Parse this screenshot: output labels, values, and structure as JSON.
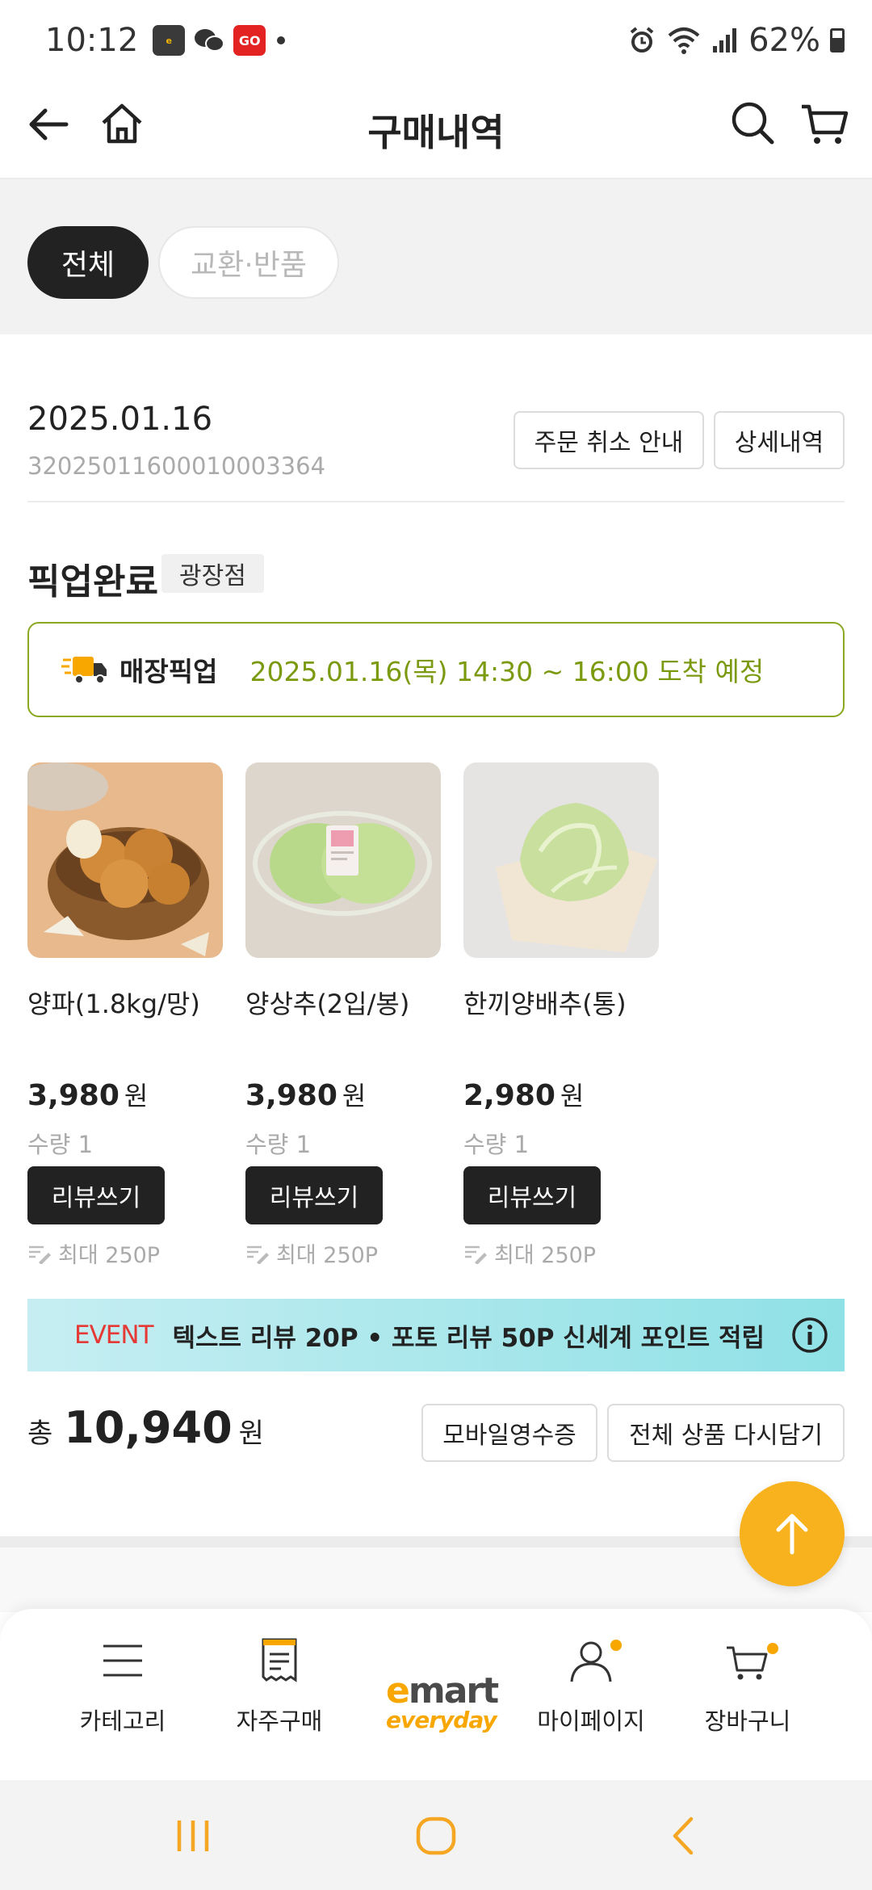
{
  "status_bar": {
    "time": "10:12",
    "battery": "62%",
    "app_icons": [
      "emart-emile-icon",
      "wechat-icon",
      "go-app-icon"
    ],
    "go_label": "GO"
  },
  "header": {
    "title": "구매내역"
  },
  "tabs": {
    "all": "전체",
    "exchange_return": "교환·반품"
  },
  "order": {
    "date": "2025.01.16",
    "number": "32025011600010003364",
    "cancel_guide_label": "주문 취소 안내",
    "detail_label": "상세내역",
    "status": "픽업완료",
    "store": "광장점",
    "pickup_type": "매장픽업",
    "pickup_time": "2025.01.16(목) 14:30 ~ 16:00 도착 예정"
  },
  "products": [
    {
      "name": "양파(1.8kg/망)",
      "price": "3,980",
      "currency": "원",
      "quantity": "수량 1",
      "review_label": "리뷰쓰기",
      "points": "최대 250P"
    },
    {
      "name": "양상추(2입/봉)",
      "price": "3,980",
      "currency": "원",
      "quantity": "수량 1",
      "review_label": "리뷰쓰기",
      "points": "최대 250P"
    },
    {
      "name": "한끼양배추(통)",
      "price": "2,980",
      "currency": "원",
      "quantity": "수량 1",
      "review_label": "리뷰쓰기",
      "points": "최대 250P"
    }
  ],
  "event": {
    "label": "EVENT",
    "text": "텍스트 리뷰 20P • 포토 리뷰 50P 신세계 포인트 적립"
  },
  "total": {
    "prefix": "총",
    "amount": "10,940",
    "unit": "원",
    "receipt_label": "모바일영수증",
    "reorder_label": "전체 상품 다시담기"
  },
  "bottom_nav": {
    "category": "카테고리",
    "frequent": "자주구매",
    "logo_line1": "emart",
    "logo_line2": "everyday",
    "mypage": "마이페이지",
    "cart": "장바구니"
  },
  "colors": {
    "accent": "#f8b21d",
    "pickup_green": "#7b9a10",
    "event_red": "#e53935",
    "dark": "#222222"
  }
}
